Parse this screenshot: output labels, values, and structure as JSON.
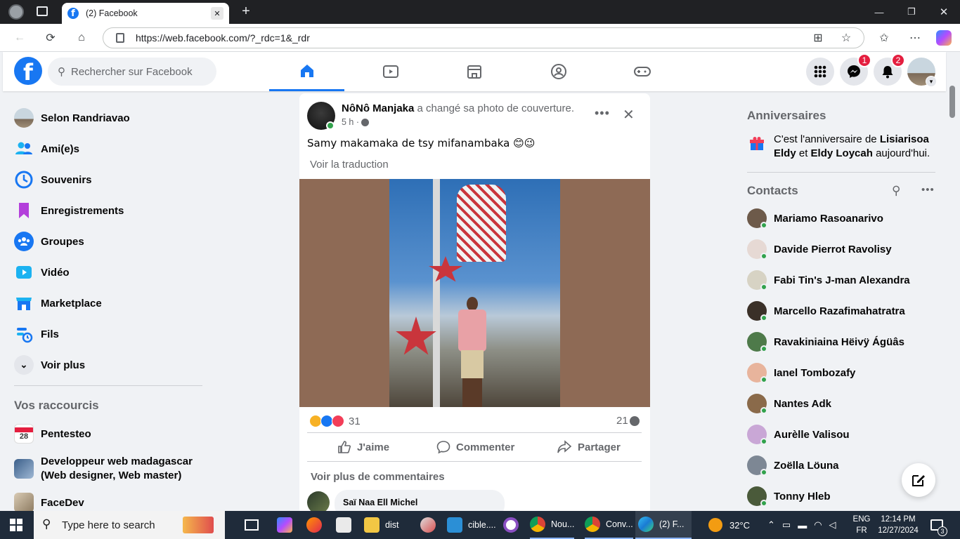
{
  "browser": {
    "tab_title": "(2) Facebook",
    "url": "https://web.facebook.com/?_rdc=1&_rdr"
  },
  "header": {
    "search_placeholder": "Rechercher sur Facebook",
    "messenger_badge": "1",
    "notifications_badge": "2"
  },
  "sidebar": {
    "items": [
      {
        "label": "Selon Randriavao",
        "icon": "profile-avatar"
      },
      {
        "label": "Ami(e)s",
        "icon": "friends-icon"
      },
      {
        "label": "Souvenirs",
        "icon": "memories-icon"
      },
      {
        "label": "Enregistrements",
        "icon": "bookmark-icon"
      },
      {
        "label": "Groupes",
        "icon": "groups-icon"
      },
      {
        "label": "Vidéo",
        "icon": "video-icon"
      },
      {
        "label": "Marketplace",
        "icon": "marketplace-icon"
      },
      {
        "label": "Fils",
        "icon": "feeds-icon"
      },
      {
        "label": "Voir plus",
        "icon": "chevron-down-icon"
      }
    ],
    "shortcuts_title": "Vos raccourcis",
    "shortcuts": [
      {
        "label": "Pentesteo",
        "icon_text": "28"
      },
      {
        "label": "Developpeur web madagascar (Web designer, Web master)"
      },
      {
        "label": "FaceDev"
      }
    ]
  },
  "post": {
    "author": "NôNô Manjaka",
    "action": "a changé sa photo de couverture.",
    "time": "5 h ·",
    "text": "Samy makamaka de tsy mifanambaka 😊😉",
    "translate": "Voir la traduction",
    "reactions_count": "31",
    "comments_count": "21",
    "like_label": "J'aime",
    "comment_label": "Commenter",
    "share_label": "Partager",
    "more_comments": "Voir plus de commentaires",
    "commenter": "Saï Naa Ell Michel"
  },
  "right": {
    "birthdays_title": "Anniversaires",
    "birthday_pre": "C'est l'anniversaire de ",
    "birthday_name1": "Lisiarisoa Eldy",
    "birthday_and": " et ",
    "birthday_name2": "Eldy Loycah",
    "birthday_post": " aujourd'hui.",
    "contacts_title": "Contacts",
    "contacts": [
      "Mariamo Rasoanarivo",
      "Davide Pierrot Ravolisy",
      "Fabi Tin's J-man Alexandra",
      "Marcello Razafimahatratra",
      "Ravakiniaina Hëivÿ Ágüâs",
      "Ianel Tombozafy",
      "Nantes Adk",
      "Aurèlle Valisou",
      "Zoëlla Löuna",
      "Tonny Hleb"
    ]
  },
  "taskbar": {
    "search_placeholder": "Type here to search",
    "apps": [
      "dist",
      "cible....",
      "Nou...",
      "Conv...",
      "(2) F..."
    ],
    "weather": "32°C",
    "lang1": "ENG",
    "lang2": "FR",
    "time": "12:14 PM",
    "date": "12/27/2024",
    "notif_count": "3"
  },
  "colors": {
    "accent": "#1877f2",
    "online": "#31a24c",
    "badge": "#e41e3f"
  }
}
